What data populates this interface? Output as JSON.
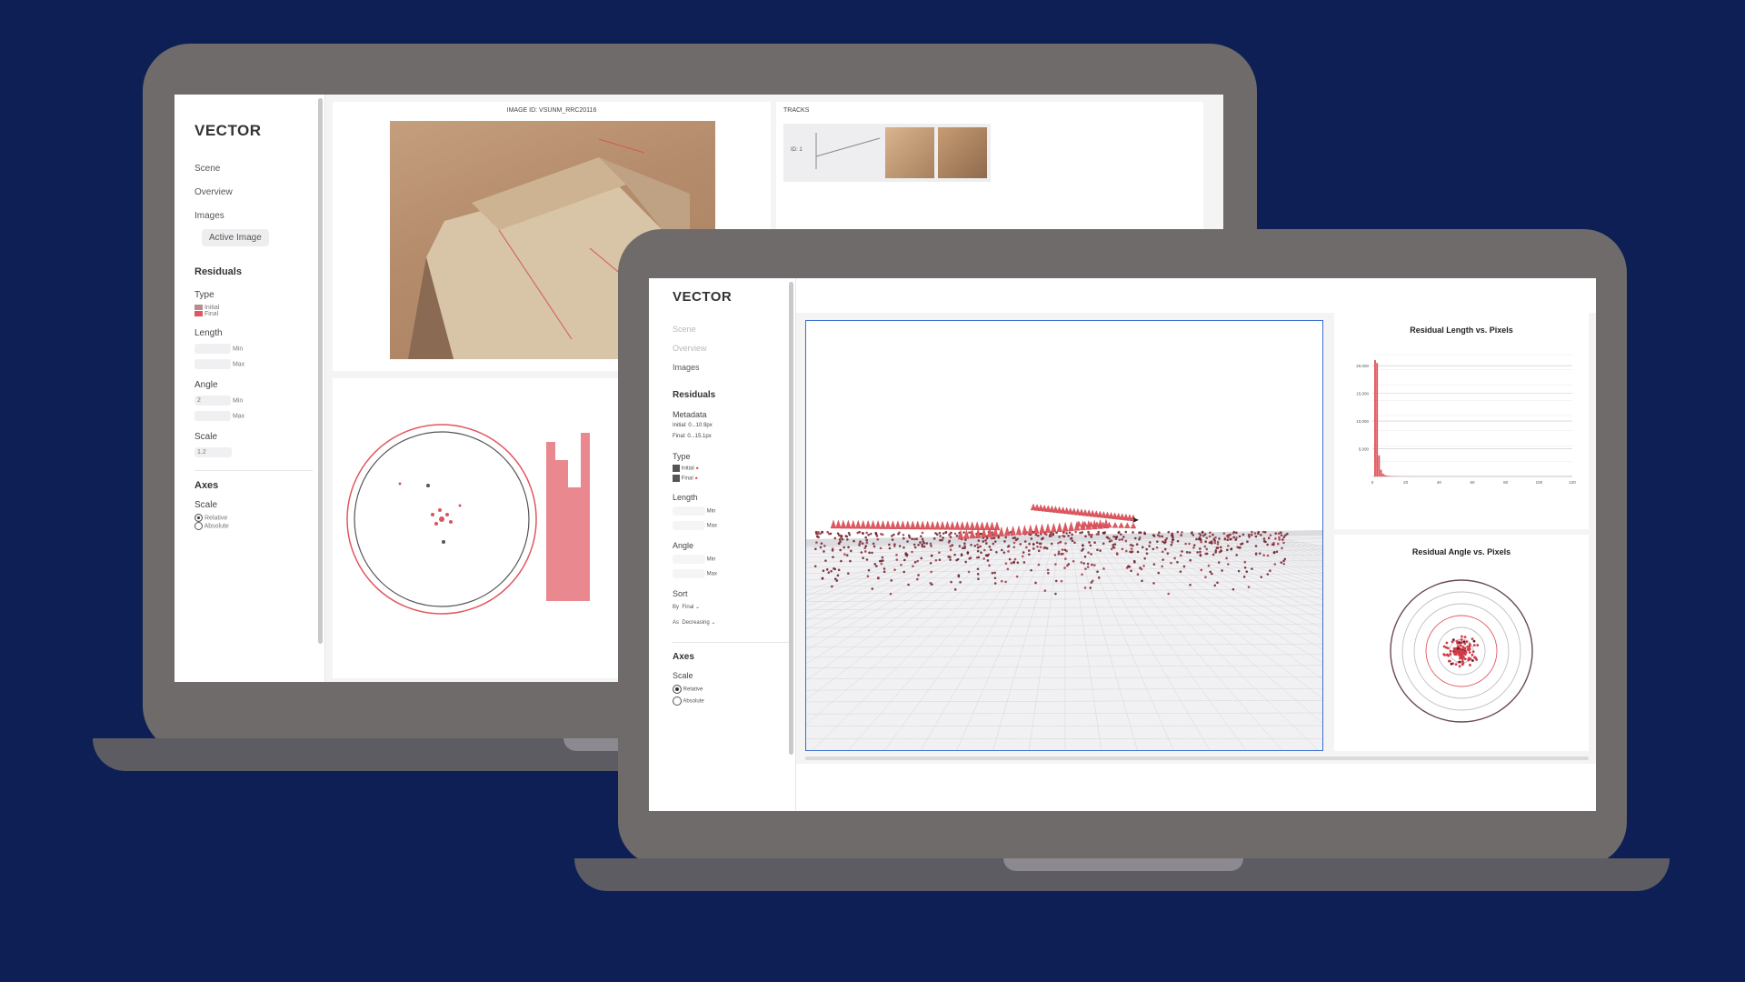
{
  "back": {
    "brand": "VECTOR",
    "nav": [
      "Scene",
      "Overview",
      "Images"
    ],
    "active_image": "Active Image",
    "residuals": "Residuals",
    "type": "Type",
    "type_items": [
      "Initial",
      "Final"
    ],
    "length": "Length",
    "length_fields": [
      "Min",
      "Max"
    ],
    "angle": "Angle",
    "angle_value": "2",
    "angle_fields": [
      "Min",
      "Max"
    ],
    "scale": "Scale",
    "scale_value": "1.2",
    "axes": "Axes",
    "axes_scale": "Scale",
    "axes_options": [
      "Relative",
      "Absolute"
    ],
    "image_title": "IMAGE ID: VSUNM_RRC20116",
    "tracks": "TRACKS",
    "track_id": "ID: 1"
  },
  "front": {
    "brand": "VECTOR",
    "nav": [
      "Scene",
      "Overview",
      "Images"
    ],
    "residuals": "Residuals",
    "metadata": "Metadata",
    "metadata_lines": [
      "Initial: 0...10.9px",
      "Final: 0...15.1px"
    ],
    "type": "Type",
    "type_items": [
      "Initial",
      "Final"
    ],
    "length": "Length",
    "length_fields": [
      "Min",
      "Max"
    ],
    "angle": "Angle",
    "angle_fields": [
      "Min",
      "Max"
    ],
    "sort": "Sort",
    "sort_by_label": "By",
    "sort_by_value": "Final",
    "sort_as_label": "As",
    "sort_as_value": "Decreasing",
    "axes": "Axes",
    "axes_scale": "Scale",
    "axes_options": [
      "Relative",
      "Absolute"
    ],
    "chart1_title": "Residual Length vs. Pixels",
    "chart2_title": "Residual Angle vs. Pixels"
  },
  "colors": {
    "background": "#0e1f55",
    "accent_red": "#e0575f",
    "viewport_border": "#3a6fd0"
  },
  "chart_data": [
    {
      "type": "bar",
      "title": "Residual Length vs. Pixels",
      "y_tick_labels": [
        "20,000",
        "15,000",
        "10,000",
        "5,000"
      ],
      "x_tick_labels": [
        "0",
        "20",
        "40",
        "60",
        "80",
        "100",
        "120"
      ],
      "values": [
        21000,
        20500,
        3800,
        1200,
        500,
        250,
        150,
        100,
        70,
        50,
        40,
        30,
        25,
        20,
        15,
        12,
        10,
        8,
        6,
        5
      ],
      "ylim": [
        0,
        22000
      ],
      "grid": true
    },
    {
      "type": "scatter",
      "title": "Residual Angle vs. Pixels",
      "ring_count": 6
    }
  ]
}
